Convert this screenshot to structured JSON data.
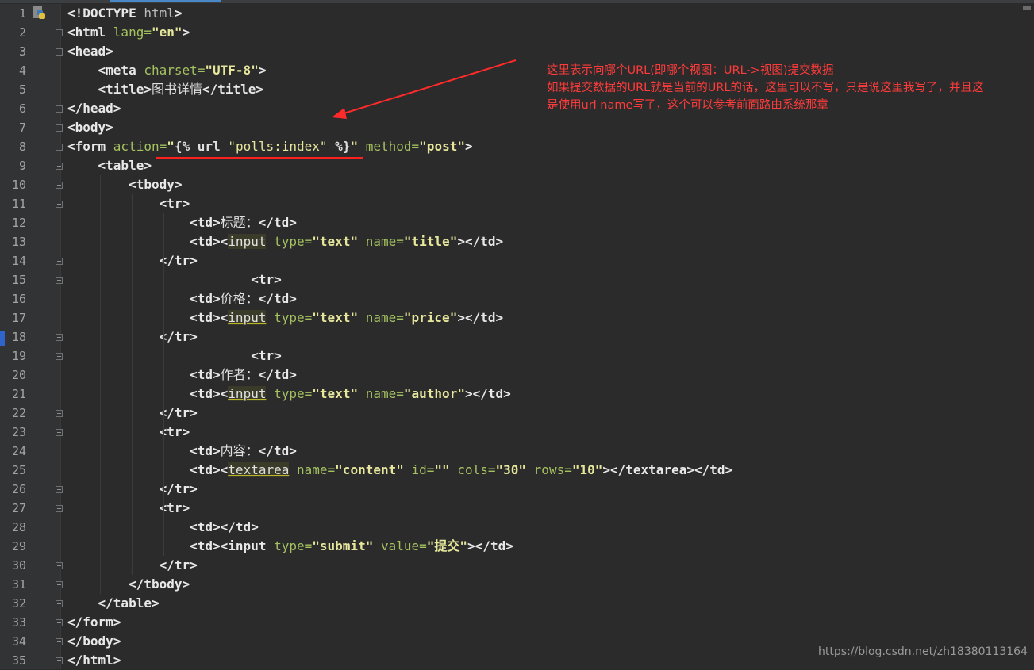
{
  "editor": {
    "lines": [
      {
        "n": "1",
        "parts": [
          [
            "tag",
            "<!DOCTYPE "
          ],
          [
            "attr",
            "html"
          ],
          [
            "tag",
            ">"
          ]
        ]
      },
      {
        "n": "2",
        "parts": [
          [
            "tag",
            "<html "
          ],
          [
            "attrn",
            "lang="
          ],
          [
            "aval",
            "\"en\""
          ],
          [
            "tag",
            ">"
          ]
        ]
      },
      {
        "n": "3",
        "parts": [
          [
            "tag",
            "<head>"
          ]
        ]
      },
      {
        "n": "4",
        "parts": [
          [
            "plain",
            "    "
          ],
          [
            "tag",
            "<meta "
          ],
          [
            "attrn",
            "charset="
          ],
          [
            "aval",
            "\"UTF-8\""
          ],
          [
            "tag",
            ">"
          ]
        ]
      },
      {
        "n": "5",
        "parts": [
          [
            "plain",
            "    "
          ],
          [
            "tag",
            "<title>"
          ],
          [
            "plain",
            "图书详情"
          ],
          [
            "tag",
            "</title>"
          ]
        ]
      },
      {
        "n": "6",
        "parts": [
          [
            "tag",
            "</head>"
          ]
        ]
      },
      {
        "n": "7",
        "parts": [
          [
            "tag",
            "<body>"
          ]
        ]
      },
      {
        "n": "8",
        "parts": [
          [
            "tag",
            "<form "
          ],
          [
            "attrn",
            "action="
          ],
          [
            "aval",
            "\""
          ],
          [
            "tpl",
            "{% url "
          ],
          [
            "tplstr",
            "\"polls:index\""
          ],
          [
            "tpl",
            " %}"
          ],
          [
            "aval",
            "\""
          ],
          [
            "plain",
            " "
          ],
          [
            "attrn",
            "method="
          ],
          [
            "aval",
            "\"post\""
          ],
          [
            "tag",
            ">"
          ]
        ]
      },
      {
        "n": "9",
        "parts": [
          [
            "plain",
            "    "
          ],
          [
            "tag",
            "<table>"
          ]
        ]
      },
      {
        "n": "10",
        "parts": [
          [
            "plain",
            "        "
          ],
          [
            "tag",
            "<tbody>"
          ]
        ]
      },
      {
        "n": "11",
        "parts": [
          [
            "plain",
            "            "
          ],
          [
            "tag",
            "<tr>"
          ]
        ]
      },
      {
        "n": "12",
        "parts": [
          [
            "plain",
            "                "
          ],
          [
            "tag",
            "<td>"
          ],
          [
            "plain",
            "标题："
          ],
          [
            "tag",
            "</td>"
          ]
        ]
      },
      {
        "n": "13",
        "parts": [
          [
            "plain",
            "                "
          ],
          [
            "tag",
            "<td><"
          ],
          [
            "warn",
            "input"
          ],
          [
            "plain",
            " "
          ],
          [
            "attrn",
            "type="
          ],
          [
            "aval",
            "\"text\""
          ],
          [
            "plain",
            " "
          ],
          [
            "attrn",
            "name="
          ],
          [
            "aval",
            "\"title\""
          ],
          [
            "tag",
            "></td>"
          ]
        ]
      },
      {
        "n": "14",
        "parts": [
          [
            "plain",
            "            "
          ],
          [
            "tag",
            "</tr>"
          ]
        ]
      },
      {
        "n": "15",
        "parts": [
          [
            "plain",
            "                        "
          ],
          [
            "tag",
            "<tr>"
          ]
        ]
      },
      {
        "n": "16",
        "parts": [
          [
            "plain",
            "                "
          ],
          [
            "tag",
            "<td>"
          ],
          [
            "plain",
            "价格："
          ],
          [
            "tag",
            "</td>"
          ]
        ]
      },
      {
        "n": "17",
        "parts": [
          [
            "plain",
            "                "
          ],
          [
            "tag",
            "<td><"
          ],
          [
            "warn",
            "input"
          ],
          [
            "plain",
            " "
          ],
          [
            "attrn",
            "type="
          ],
          [
            "aval",
            "\"text\""
          ],
          [
            "plain",
            " "
          ],
          [
            "attrn",
            "name="
          ],
          [
            "aval",
            "\"price\""
          ],
          [
            "tag",
            "></td>"
          ]
        ]
      },
      {
        "n": "18",
        "parts": [
          [
            "plain",
            "            "
          ],
          [
            "tag",
            "</tr>"
          ]
        ]
      },
      {
        "n": "19",
        "parts": [
          [
            "plain",
            "                        "
          ],
          [
            "tag",
            "<tr>"
          ]
        ]
      },
      {
        "n": "20",
        "parts": [
          [
            "plain",
            "                "
          ],
          [
            "tag",
            "<td>"
          ],
          [
            "plain",
            "作者："
          ],
          [
            "tag",
            "</td>"
          ]
        ]
      },
      {
        "n": "21",
        "parts": [
          [
            "plain",
            "                "
          ],
          [
            "tag",
            "<td><"
          ],
          [
            "warn",
            "input"
          ],
          [
            "plain",
            " "
          ],
          [
            "attrn",
            "type="
          ],
          [
            "aval",
            "\"text\""
          ],
          [
            "plain",
            " "
          ],
          [
            "attrn",
            "name="
          ],
          [
            "aval",
            "\"author\""
          ],
          [
            "tag",
            "></td>"
          ]
        ]
      },
      {
        "n": "22",
        "parts": [
          [
            "plain",
            "            "
          ],
          [
            "tag",
            "</tr>"
          ]
        ]
      },
      {
        "n": "23",
        "parts": [
          [
            "plain",
            "            "
          ],
          [
            "tag",
            "<tr>"
          ]
        ]
      },
      {
        "n": "24",
        "parts": [
          [
            "plain",
            "                "
          ],
          [
            "tag",
            "<td>"
          ],
          [
            "plain",
            "内容："
          ],
          [
            "tag",
            "</td>"
          ]
        ]
      },
      {
        "n": "25",
        "parts": [
          [
            "plain",
            "                "
          ],
          [
            "tag",
            "<td><"
          ],
          [
            "warn",
            "textarea"
          ],
          [
            "plain",
            " "
          ],
          [
            "attrn",
            "name="
          ],
          [
            "aval",
            "\"content\""
          ],
          [
            "plain",
            " "
          ],
          [
            "attrn",
            "id="
          ],
          [
            "aval",
            "\"\""
          ],
          [
            "plain",
            " "
          ],
          [
            "attrn",
            "cols="
          ],
          [
            "aval",
            "\"30\""
          ],
          [
            "plain",
            " "
          ],
          [
            "attrn",
            "rows="
          ],
          [
            "aval",
            "\"10\""
          ],
          [
            "tag",
            "></textarea></td>"
          ]
        ]
      },
      {
        "n": "26",
        "parts": [
          [
            "plain",
            "            "
          ],
          [
            "tag",
            "</tr>"
          ]
        ]
      },
      {
        "n": "27",
        "parts": [
          [
            "plain",
            "            "
          ],
          [
            "tag",
            "<tr>"
          ]
        ]
      },
      {
        "n": "28",
        "parts": [
          [
            "plain",
            "                "
          ],
          [
            "tag",
            "<td></td>"
          ]
        ]
      },
      {
        "n": "29",
        "parts": [
          [
            "plain",
            "                "
          ],
          [
            "tag",
            "<td><input "
          ],
          [
            "attrn",
            "type="
          ],
          [
            "aval",
            "\"submit\""
          ],
          [
            "plain",
            " "
          ],
          [
            "attrn",
            "value="
          ],
          [
            "aval",
            "\"提交\""
          ],
          [
            "tag",
            "></td>"
          ]
        ]
      },
      {
        "n": "30",
        "parts": [
          [
            "plain",
            "            "
          ],
          [
            "tag",
            "</tr>"
          ]
        ]
      },
      {
        "n": "31",
        "parts": [
          [
            "plain",
            "        "
          ],
          [
            "tag",
            "</tbody>"
          ]
        ]
      },
      {
        "n": "32",
        "parts": [
          [
            "plain",
            "    "
          ],
          [
            "tag",
            "</table>"
          ]
        ]
      },
      {
        "n": "33",
        "parts": [
          [
            "tag",
            "</form>"
          ]
        ]
      },
      {
        "n": "34",
        "parts": [
          [
            "tag",
            "</body>"
          ]
        ]
      },
      {
        "n": "35",
        "parts": [
          [
            "tag",
            "</html>"
          ]
        ]
      }
    ],
    "fold_lines": [
      "2",
      "3",
      "6",
      "7",
      "8",
      "9",
      "10",
      "11",
      "14",
      "15",
      "18",
      "19",
      "22",
      "23",
      "26",
      "27",
      "30",
      "31",
      "32",
      "33",
      "34",
      "35"
    ]
  },
  "annotation": {
    "line1": "这里表示向哪个URL(即哪个视图：URL->视图)提交数据",
    "line2": "如果提交数据的URL就是当前的URL的话，这里可以不写，只是说这里我写了，并且这",
    "line3": "是使用url name写了，这个可以参考前面路由系统那章",
    "color": "#ff3b3b"
  },
  "watermark": "https://blog.csdn.net/zh18380113164",
  "file_icon": "python-file-icon"
}
